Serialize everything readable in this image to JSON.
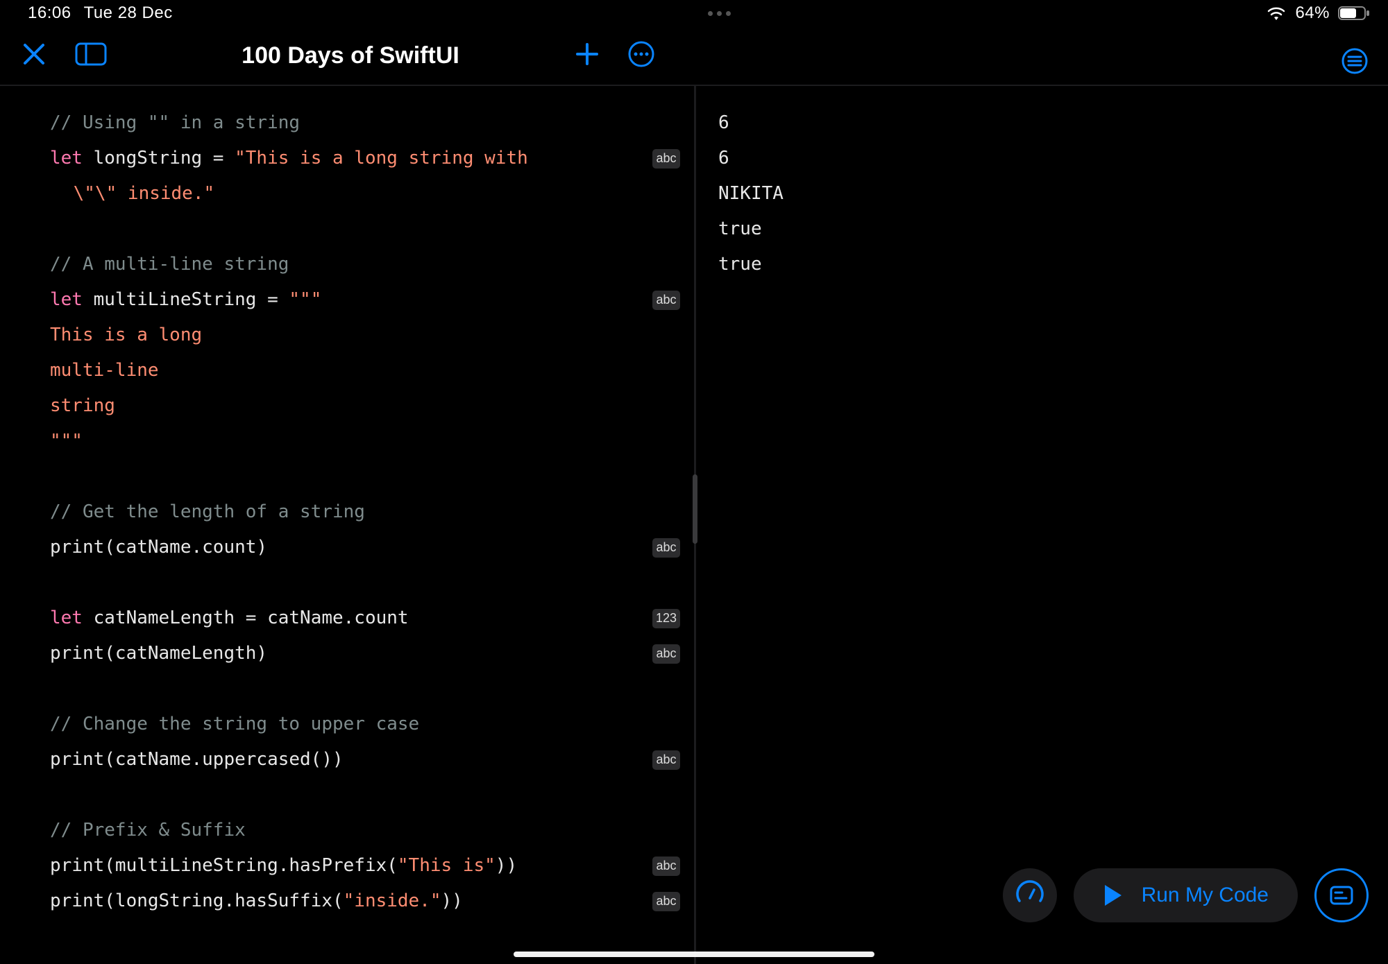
{
  "status": {
    "time": "16:06",
    "date": "Tue 28 Dec",
    "battery": "64%"
  },
  "toolbar": {
    "title": "100 Days of SwiftUI"
  },
  "code": {
    "lines": [
      {
        "cmt": "// Using \"\" in a string"
      },
      {
        "kw": "let",
        "rest1": " longString = ",
        "str1": "\"This is a long string with"
      },
      {
        "indent": true,
        "str1": " \\\"\\\" inside.\""
      },
      {
        "blank": true
      },
      {
        "cmt": "// A multi-line string"
      },
      {
        "kw": "let",
        "rest1": " multiLineString = ",
        "str1": "\"\"\""
      },
      {
        "str1": "This is a long"
      },
      {
        "str1": "multi-line"
      },
      {
        "str1": "string"
      },
      {
        "str1": "\"\"\""
      },
      {
        "blank": true
      },
      {
        "cmt": "// Get the length of a string"
      },
      {
        "fg": "print(catName.count)"
      },
      {
        "blank": true
      },
      {
        "kw": "let",
        "rest1": " catNameLength = catName.count"
      },
      {
        "fg": "print(catNameLength)"
      },
      {
        "blank": true
      },
      {
        "cmt": "// Change the string to upper case"
      },
      {
        "fg1": "print(catName.uppercased())"
      },
      {
        "blank": true
      },
      {
        "cmt": "// Prefix & Suffix"
      },
      {
        "fg1": "print(multiLineString.hasPrefix(",
        "str1": "\"This is\"",
        "fg2": "))"
      },
      {
        "fg1": "print(longString.hasSuffix(",
        "str1": "\"inside.\"",
        "fg2": "))"
      }
    ]
  },
  "badges": [
    {
      "text": "abc",
      "line": 1
    },
    {
      "text": "abc",
      "line": 5
    },
    {
      "text": "abc",
      "line": 12
    },
    {
      "text": "123",
      "line": 14
    },
    {
      "text": "abc",
      "line": 15
    },
    {
      "text": "abc",
      "line": 18
    },
    {
      "text": "abc",
      "line": 21
    },
    {
      "text": "abc",
      "line": 22
    }
  ],
  "console": [
    "6",
    "6",
    "NIKITA",
    "true",
    "true"
  ],
  "run": {
    "label": "Run My Code"
  }
}
